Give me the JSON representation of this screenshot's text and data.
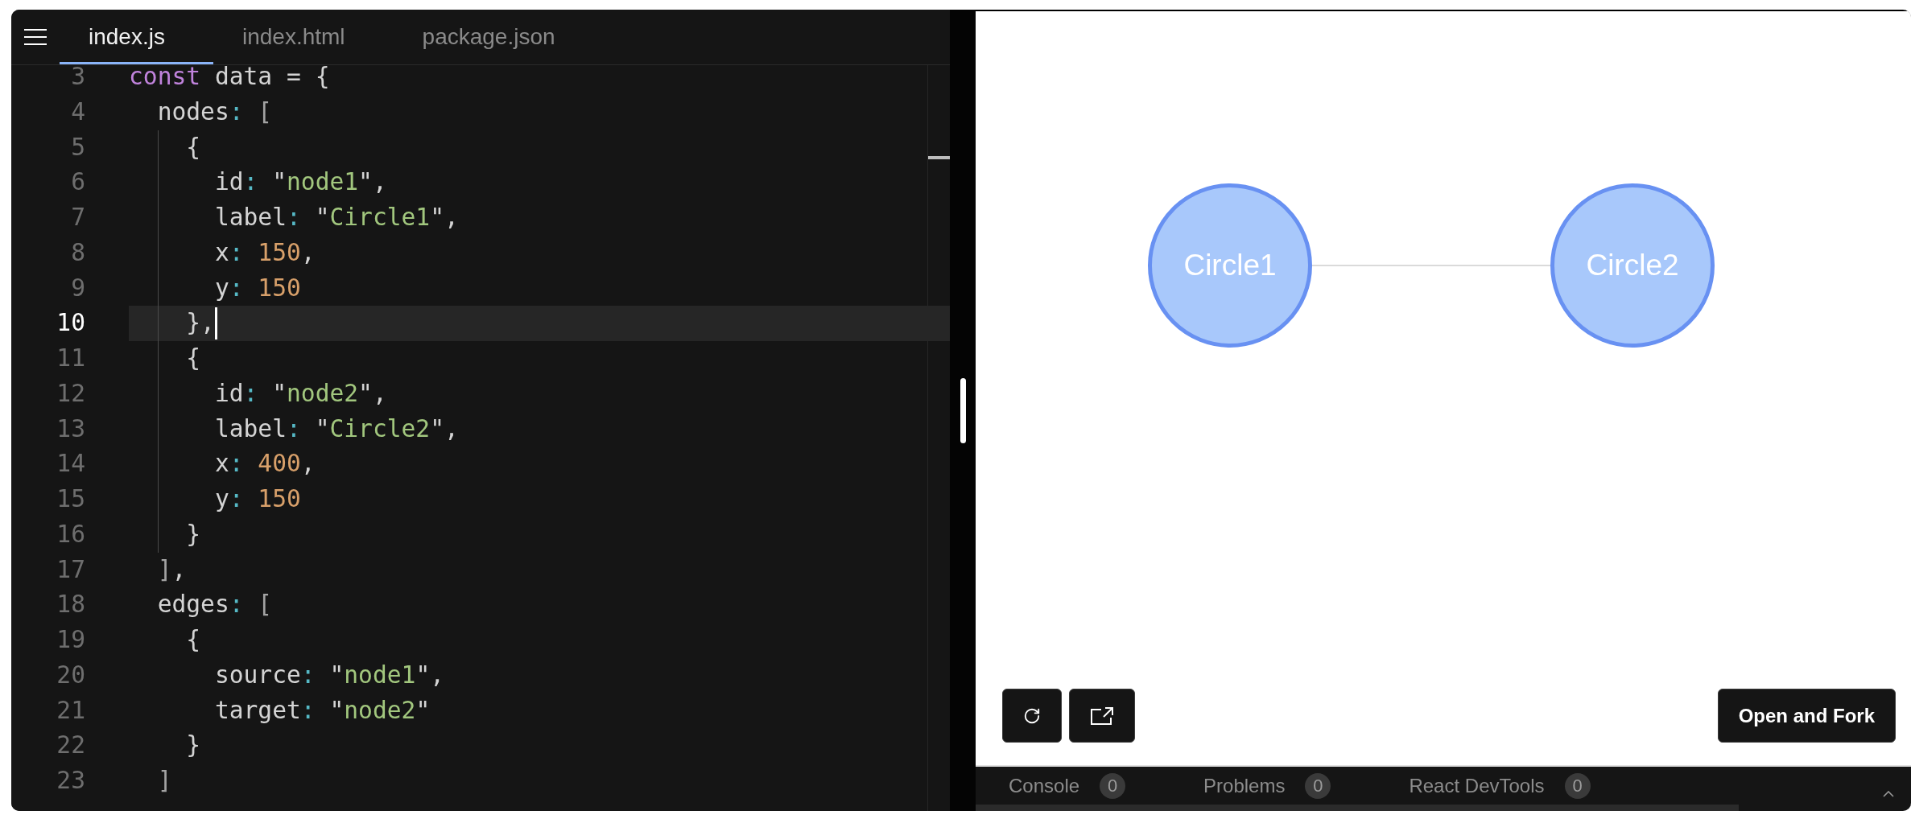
{
  "editor": {
    "tabs": [
      {
        "label": "index.js",
        "selected": true
      },
      {
        "label": "index.html",
        "selected": false
      },
      {
        "label": "package.json",
        "selected": false
      }
    ],
    "lines": [
      {
        "number": "3",
        "active": false,
        "guide": false,
        "tokens": [
          {
            "kind": "keyword",
            "text": "const"
          },
          {
            "kind": "plain",
            "text": " data = {"
          }
        ]
      },
      {
        "number": "4",
        "active": false,
        "guide": false,
        "tokens": [
          {
            "kind": "plain",
            "text": "  nodes"
          },
          {
            "kind": "colon",
            "text": ": "
          },
          {
            "kind": "bracket",
            "text": "["
          }
        ]
      },
      {
        "number": "5",
        "active": false,
        "guide": true,
        "tokens": [
          {
            "kind": "plain",
            "text": "    {"
          }
        ]
      },
      {
        "number": "6",
        "active": false,
        "guide": true,
        "tokens": [
          {
            "kind": "plain",
            "text": "      id"
          },
          {
            "kind": "colon",
            "text": ": "
          },
          {
            "kind": "plain",
            "text": "\""
          },
          {
            "kind": "string",
            "text": "node1"
          },
          {
            "kind": "plain",
            "text": "\","
          }
        ]
      },
      {
        "number": "7",
        "active": false,
        "guide": true,
        "tokens": [
          {
            "kind": "plain",
            "text": "      label"
          },
          {
            "kind": "colon",
            "text": ": "
          },
          {
            "kind": "plain",
            "text": "\""
          },
          {
            "kind": "string",
            "text": "Circle1"
          },
          {
            "kind": "plain",
            "text": "\","
          }
        ]
      },
      {
        "number": "8",
        "active": false,
        "guide": true,
        "tokens": [
          {
            "kind": "plain",
            "text": "      x"
          },
          {
            "kind": "colon",
            "text": ": "
          },
          {
            "kind": "number",
            "text": "150"
          },
          {
            "kind": "plain",
            "text": ","
          }
        ]
      },
      {
        "number": "9",
        "active": false,
        "guide": true,
        "tokens": [
          {
            "kind": "plain",
            "text": "      y"
          },
          {
            "kind": "colon",
            "text": ": "
          },
          {
            "kind": "number",
            "text": "150"
          }
        ]
      },
      {
        "number": "10",
        "active": true,
        "guide": true,
        "tokens": [
          {
            "kind": "plain",
            "text": "    },"
          }
        ]
      },
      {
        "number": "11",
        "active": false,
        "guide": true,
        "tokens": [
          {
            "kind": "plain",
            "text": "    {"
          }
        ]
      },
      {
        "number": "12",
        "active": false,
        "guide": true,
        "tokens": [
          {
            "kind": "plain",
            "text": "      id"
          },
          {
            "kind": "colon",
            "text": ": "
          },
          {
            "kind": "plain",
            "text": "\""
          },
          {
            "kind": "string",
            "text": "node2"
          },
          {
            "kind": "plain",
            "text": "\","
          }
        ]
      },
      {
        "number": "13",
        "active": false,
        "guide": true,
        "tokens": [
          {
            "kind": "plain",
            "text": "      label"
          },
          {
            "kind": "colon",
            "text": ": "
          },
          {
            "kind": "plain",
            "text": "\""
          },
          {
            "kind": "string",
            "text": "Circle2"
          },
          {
            "kind": "plain",
            "text": "\","
          }
        ]
      },
      {
        "number": "14",
        "active": false,
        "guide": true,
        "tokens": [
          {
            "kind": "plain",
            "text": "      x"
          },
          {
            "kind": "colon",
            "text": ": "
          },
          {
            "kind": "number",
            "text": "400"
          },
          {
            "kind": "plain",
            "text": ","
          }
        ]
      },
      {
        "number": "15",
        "active": false,
        "guide": true,
        "tokens": [
          {
            "kind": "plain",
            "text": "      y"
          },
          {
            "kind": "colon",
            "text": ": "
          },
          {
            "kind": "number",
            "text": "150"
          }
        ]
      },
      {
        "number": "16",
        "active": false,
        "guide": true,
        "tokens": [
          {
            "kind": "plain",
            "text": "    }"
          }
        ]
      },
      {
        "number": "17",
        "active": false,
        "guide": false,
        "tokens": [
          {
            "kind": "bracket",
            "text": "  ]"
          },
          {
            "kind": "plain",
            "text": ","
          }
        ]
      },
      {
        "number": "18",
        "active": false,
        "guide": false,
        "tokens": [
          {
            "kind": "plain",
            "text": "  edges"
          },
          {
            "kind": "colon",
            "text": ": "
          },
          {
            "kind": "bracket",
            "text": "["
          }
        ]
      },
      {
        "number": "19",
        "active": false,
        "guide": false,
        "tokens": [
          {
            "kind": "plain",
            "text": "    {"
          }
        ]
      },
      {
        "number": "20",
        "active": false,
        "guide": false,
        "tokens": [
          {
            "kind": "plain",
            "text": "      source"
          },
          {
            "kind": "colon",
            "text": ": "
          },
          {
            "kind": "plain",
            "text": "\""
          },
          {
            "kind": "string",
            "text": "node1"
          },
          {
            "kind": "plain",
            "text": "\","
          }
        ]
      },
      {
        "number": "21",
        "active": false,
        "guide": false,
        "tokens": [
          {
            "kind": "plain",
            "text": "      target"
          },
          {
            "kind": "colon",
            "text": ": "
          },
          {
            "kind": "plain",
            "text": "\""
          },
          {
            "kind": "string",
            "text": "node2"
          },
          {
            "kind": "plain",
            "text": "\""
          }
        ]
      },
      {
        "number": "22",
        "active": false,
        "guide": false,
        "tokens": [
          {
            "kind": "plain",
            "text": "    }"
          }
        ]
      },
      {
        "number": "23",
        "active": false,
        "guide": false,
        "tokens": [
          {
            "kind": "bracket",
            "text": "  ]"
          }
        ]
      }
    ]
  },
  "preview": {
    "graph": {
      "nodes": [
        {
          "label": "Circle1"
        },
        {
          "label": "Circle2"
        }
      ]
    },
    "fork_button": "Open and Fork"
  },
  "devtools": {
    "tabs": [
      {
        "label": "Console",
        "count": "0",
        "selected": false
      },
      {
        "label": "Problems",
        "count": "0",
        "selected": false
      },
      {
        "label": "React DevTools",
        "count": "0",
        "selected": false
      }
    ]
  }
}
